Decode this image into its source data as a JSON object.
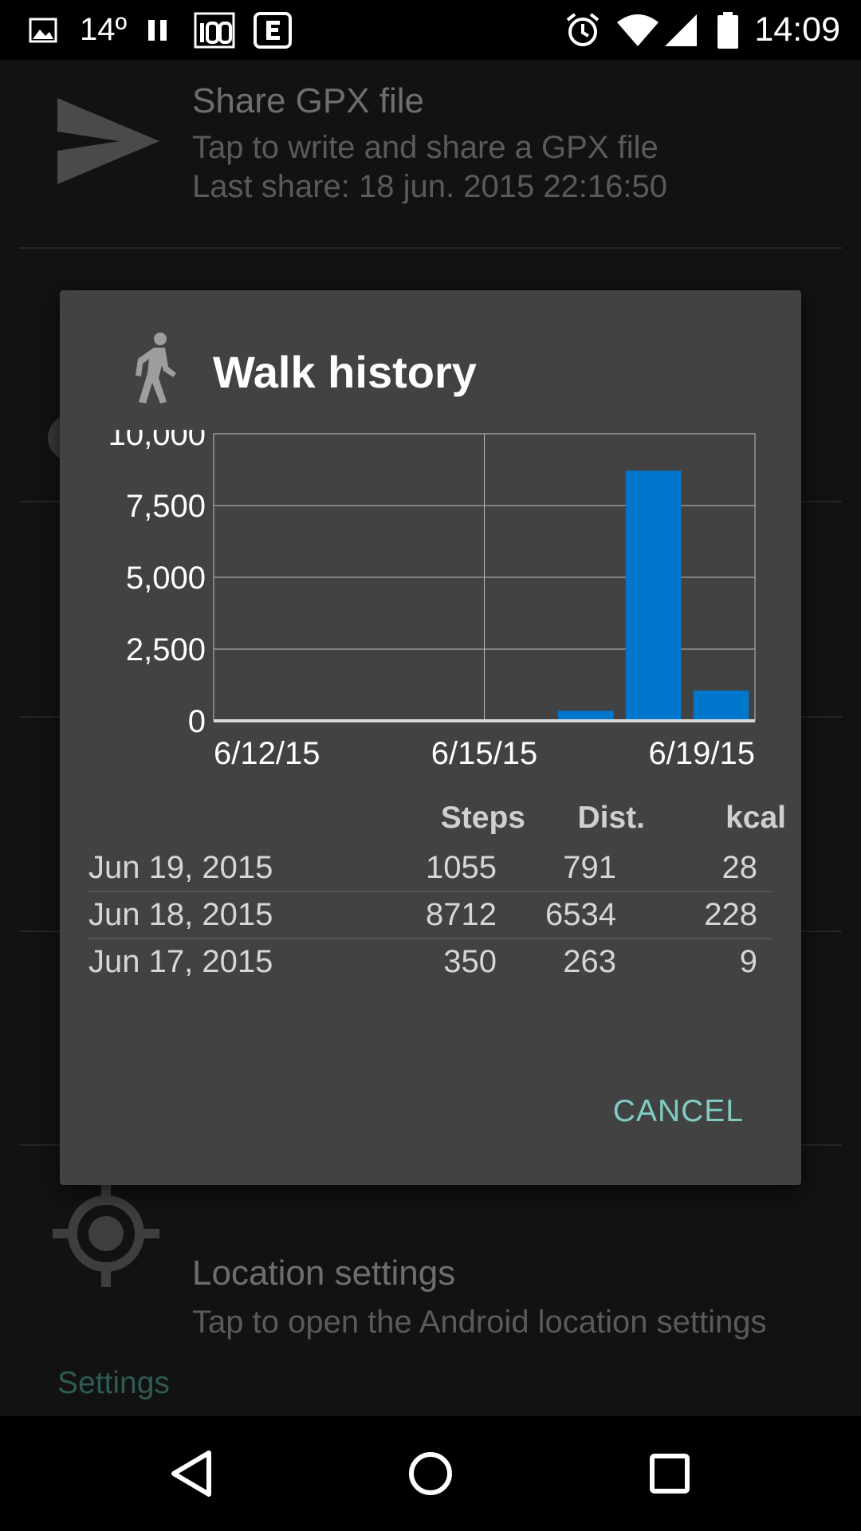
{
  "status_bar": {
    "temperature": "14º",
    "time": "14:09",
    "icons": [
      "image-icon",
      "pause-icon",
      "hundred-icon",
      "e-badge-icon",
      "alarm-icon",
      "wifi-icon",
      "signal-icon",
      "battery-icon"
    ]
  },
  "background": {
    "share_gpx": {
      "title": "Share GPX file",
      "subtitle": "Tap to write and share a GPX file",
      "last_share": "Last share: 18 jun. 2015 22:16:50"
    },
    "location_settings": {
      "title": "Location settings",
      "subtitle": "Tap to open the Android location settings"
    },
    "settings_category": "Settings"
  },
  "dialog": {
    "title": "Walk history",
    "icon": "walk-icon",
    "cancel_label": "CANCEL",
    "table": {
      "headers": [
        "Steps",
        "Dist.",
        "kcal"
      ],
      "rows": [
        {
          "date": "Jun 19, 2015",
          "steps": "1055",
          "dist": "791",
          "kcal": "28"
        },
        {
          "date": "Jun 18, 2015",
          "steps": "8712",
          "dist": "6534",
          "kcal": "228"
        },
        {
          "date": "Jun 17, 2015",
          "steps": "350",
          "dist": "263",
          "kcal": "9"
        }
      ]
    }
  },
  "chart_data": {
    "type": "bar",
    "x_tick_labels": [
      "6/12/15",
      "6/15/15",
      "6/19/15"
    ],
    "y_tick_labels": [
      "10,000",
      "7,500",
      "5,000",
      "2,500",
      "0"
    ],
    "ylim": [
      0,
      10000
    ],
    "grid": true,
    "bar_color": "#0077cc",
    "bars": [
      {
        "date": "6/17/15",
        "value": 350
      },
      {
        "date": "6/18/15",
        "value": 8712
      },
      {
        "date": "6/19/15",
        "value": 1055
      }
    ]
  },
  "colors": {
    "accent": "#80cbc4",
    "bar": "#0077cc",
    "dialog_bg": "#424242"
  }
}
